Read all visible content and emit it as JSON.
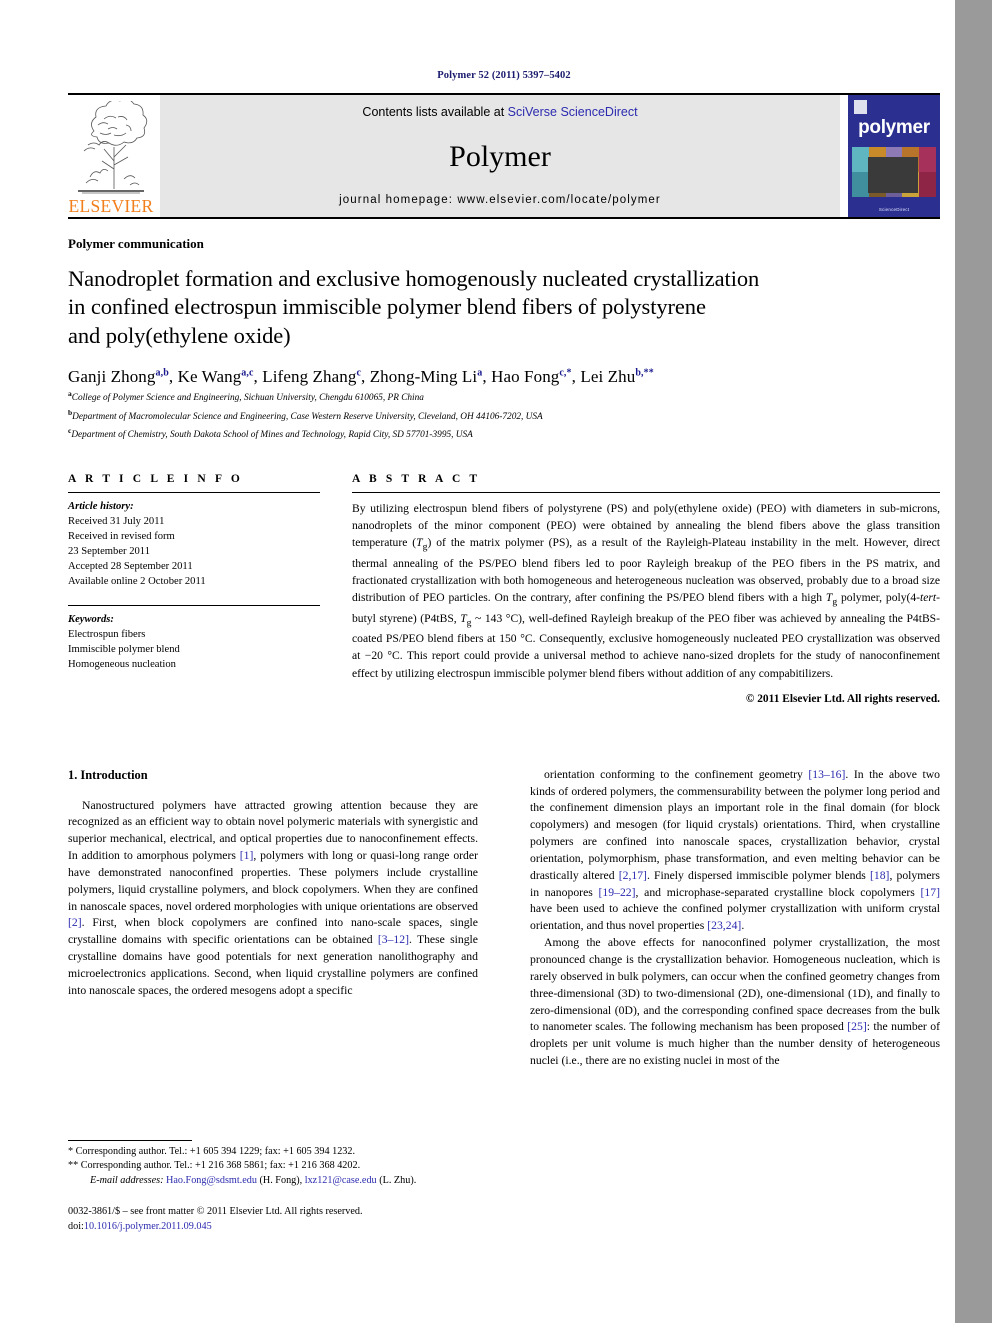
{
  "running_head": "Polymer 52 (2011) 5397–5402",
  "masthead": {
    "publisher_name": "ELSEVIER",
    "contents_prefix": "Contents lists available at ",
    "contents_link": "SciVerse ScienceDirect",
    "journal_name": "Polymer",
    "homepage": "journal homepage: www.elsevier.com/locate/polymer",
    "cover_title": "polymer",
    "cover_footer": "ScienceDirect",
    "banner_bg": "#e6e6e6",
    "cover_bg": "#2b2f8f",
    "elsevier_orange": "#F27F1B",
    "link_blue": "#2b2bb0"
  },
  "article": {
    "kind": "Polymer communication",
    "title_line1": "Nanodroplet formation and exclusive homogenously nucleated crystallization",
    "title_line2": "in confined electrospun immiscible polymer blend fibers of polystyrene",
    "title_line3": "and poly(ethylene oxide)",
    "authors": [
      {
        "name": "Ganji Zhong",
        "marks": "a,b",
        "sep": ", "
      },
      {
        "name": "Ke Wang",
        "marks": "a,c",
        "sep": ", "
      },
      {
        "name": "Lifeng Zhang",
        "marks": "c",
        "sep": ", "
      },
      {
        "name": "Zhong-Ming Li",
        "marks": "a",
        "sep": ", "
      },
      {
        "name": "Hao Fong",
        "marks": "c,*",
        "sep": ", "
      },
      {
        "name": "Lei Zhu",
        "marks": "b,**",
        "sep": ""
      }
    ],
    "affiliations": [
      {
        "mark": "a",
        "text": "College of Polymer Science and Engineering, Sichuan University, Chengdu 610065, PR China"
      },
      {
        "mark": "b",
        "text": "Department of Macromolecular Science and Engineering, Case Western Reserve University, Cleveland, OH 44106-7202, USA"
      },
      {
        "mark": "c",
        "text": "Department of Chemistry, South Dakota School of Mines and Technology, Rapid City, SD 57701-3995, USA"
      }
    ]
  },
  "info": {
    "heading": "A R T I C L E    I N F O",
    "history_label": "Article history:",
    "history": [
      "Received 31 July 2011",
      "Received in revised form",
      "23 September 2011",
      "Accepted 28 September 2011",
      "Available online 2 October 2011"
    ],
    "keywords_label": "Keywords:",
    "keywords": [
      "Electrospun fibers",
      "Immiscible polymer blend",
      "Homogeneous nucleation"
    ]
  },
  "abstract": {
    "heading": "A B S T R A C T",
    "text_part1": "By utilizing electrospun blend fibers of polystyrene (PS) and poly(ethylene oxide) (PEO) with diameters in sub-microns, nanodroplets of the minor component (PEO) were obtained by annealing the blend fibers above the glass transition temperature (",
    "tg1": "T",
    "tg1_sub": "g",
    "text_part2": ") of the matrix polymer (PS), as a result of the Rayleigh-Plateau instability in the melt. However, direct thermal annealing of the PS/PEO blend fibers led to poor Rayleigh breakup of the PEO fibers in the PS matrix, and fractionated crystallization with both homogeneous and heterogeneous nucleation was observed, probably due to a broad size distribution of PEO particles. On the contrary, after confining the PS/PEO blend fibers with a high ",
    "tg2": "T",
    "tg2_sub": "g",
    "text_part3": " polymer, poly(4-",
    "tert": "tert",
    "text_part4": "-butyl styrene) (P4tBS, ",
    "tg3": "T",
    "tg3_sub": "g",
    "text_part5": " ~ 143 °C), well-defined Rayleigh breakup of the PEO fiber was achieved by annealing the P4tBS-coated PS/PEO blend fibers at 150 °C. Consequently, exclusive homogeneously nucleated PEO crystallization was observed at −20 °C. This report could provide a universal method to achieve nano-sized droplets for the study of nanoconfinement effect by utilizing electrospun immiscible polymer blend fibers without addition of any compabitilizers.",
    "copyright": "© 2011 Elsevier Ltd. All rights reserved."
  },
  "body": {
    "section_number_title": "1.  Introduction",
    "left_p1_a": "Nanostructured polymers have attracted growing attention because they are recognized as an efficient way to obtain novel polymeric materials with synergistic and superior mechanical, electrical, and optical properties due to nanoconfinement effects. In addition to amorphous polymers ",
    "ref1": "[1]",
    "left_p1_b": ", polymers with long or quasi-long range order have demonstrated nanoconfined properties. These polymers include crystalline polymers, liquid crystalline polymers, and block copolymers. When they are confined in nanoscale spaces, novel ordered morphologies with unique orientations are observed ",
    "ref2": "[2]",
    "left_p1_c": ". First, when block copolymers are confined into nano-scale spaces, single crystalline domains with specific orientations can be obtained ",
    "ref3": "[3–12]",
    "left_p1_d": ". These single crystalline domains have good potentials for next generation nanolithography and microelectronics applications. Second, when liquid crystalline polymers are confined into nanoscale spaces, the ordered mesogens adopt a specific",
    "right_p1_a": "orientation conforming to the confinement geometry ",
    "ref4": "[13–16]",
    "right_p1_b": ". In the above two kinds of ordered polymers, the commensurability between the polymer long period and the confinement dimension plays an important role in the final domain (for block copolymers) and mesogen (for liquid crystals) orientations. Third, when crystalline polymers are confined into nanoscale spaces, crystallization behavior, crystal orientation, polymorphism, phase transformation, and even melting behavior can be drastically altered ",
    "ref5": "[2,17]",
    "right_p1_c": ". Finely dispersed immiscible polymer blends ",
    "ref6": "[18]",
    "right_p1_d": ", polymers in nanopores ",
    "ref7": "[19–22]",
    "right_p1_e": ", and microphase-separated crystalline block copolymers ",
    "ref8": "[17]",
    "right_p1_f": " have been used to achieve the confined polymer crystallization with uniform crystal orientation, and thus novel properties ",
    "ref9": "[23,24]",
    "right_p1_g": ".",
    "right_p2_a": "Among the above effects for nanoconfined polymer crystallization, the most pronounced change is the crystallization behavior. Homogeneous nucleation, which is rarely observed in bulk polymers, can occur when the confined geometry changes from three-dimensional (3D) to two-dimensional (2D), one-dimensional (1D), and finally to zero-dimensional (0D), and the corresponding confined space decreases from the bulk to nanometer scales. The following mechanism has been proposed ",
    "ref10": "[25]",
    "right_p2_b": ": the number of droplets per unit volume is much higher than the number density of heterogeneous nuclei (i.e., there are no existing nuclei in most of the"
  },
  "footnotes": {
    "line1": "*  Corresponding author. Tel.: +1 605 394 1229; fax: +1 605 394 1232.",
    "line2": "**  Corresponding author. Tel.: +1 216 368 5861; fax: +1 216 368 4202.",
    "email_label": "E-mail addresses:",
    "email1": "Hao.Fong@sdsmt.edu",
    "email1_owner": " (H. Fong), ",
    "email2": "lxz121@case.edu",
    "email2_owner": " (L. Zhu).",
    "imprint_line1": "0032-3861/$ – see front matter © 2011 Elsevier Ltd. All rights reserved.",
    "doi_label": "doi:",
    "doi_value": "10.1016/j.polymer.2011.09.045"
  }
}
